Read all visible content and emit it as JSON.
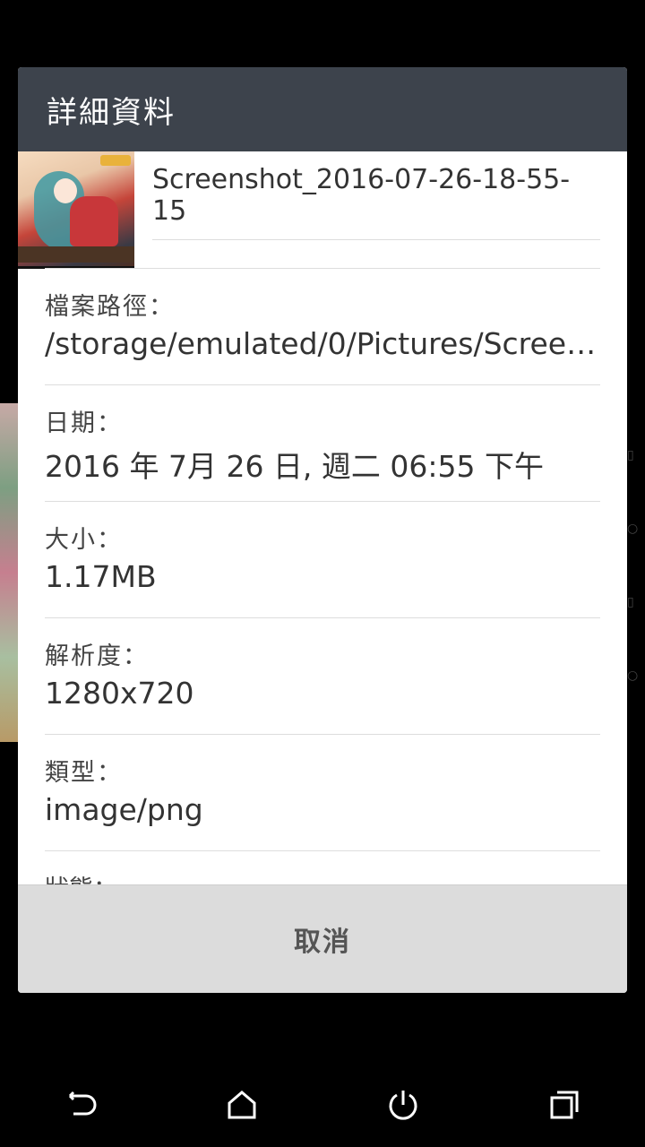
{
  "dialog": {
    "title": "詳細資料",
    "file_name": "Screenshot_2016-07-26-18-55-15",
    "details": [
      {
        "label": "檔案路徑：",
        "value": "/storage/emulated/0/Pictures/Screens…"
      },
      {
        "label": "日期：",
        "value": "2016 年 7月 26 日, 週二 06:55 下午"
      },
      {
        "label": "大小：",
        "value": "1.17MB"
      },
      {
        "label": "解析度：",
        "value": "1280x720"
      },
      {
        "label": "類型：",
        "value": "image/png"
      }
    ],
    "next_label_partial": "狀態：",
    "cancel_label": "取消"
  },
  "navbar": {
    "icons": [
      "back-icon",
      "home-icon",
      "power-icon",
      "recents-icon"
    ]
  }
}
